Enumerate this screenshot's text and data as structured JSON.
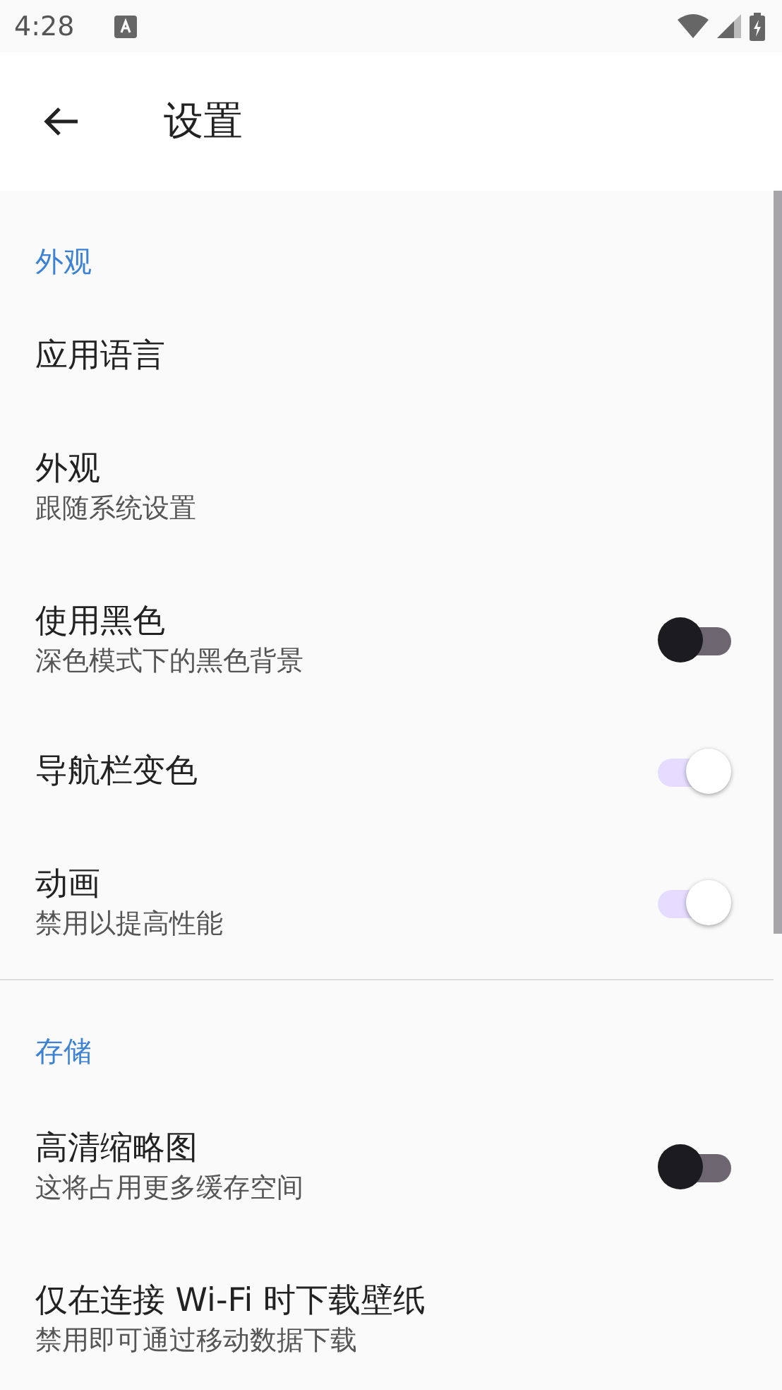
{
  "status_bar": {
    "time": "4:28"
  },
  "app_bar": {
    "title": "设置"
  },
  "sections": [
    {
      "title": "外观",
      "items": [
        {
          "kind": "plain",
          "title": "应用语言"
        },
        {
          "kind": "plain",
          "title": "外观",
          "subtitle": "跟随系统设置"
        },
        {
          "kind": "switch",
          "title": "使用黑色",
          "subtitle": "深色模式下的黑色背景",
          "on": false
        },
        {
          "kind": "switch",
          "title": "导航栏变色",
          "on": true
        },
        {
          "kind": "switch",
          "title": "动画",
          "subtitle": "禁用以提高性能",
          "on": true
        }
      ]
    },
    {
      "title": "存储",
      "items": [
        {
          "kind": "switch",
          "title": "高清缩略图",
          "subtitle": "这将占用更多缓存空间",
          "on": false
        },
        {
          "kind": "plain",
          "title": "仅在连接 Wi-Fi 时下载壁纸",
          "subtitle": "禁用即可通过移动数据下载"
        }
      ]
    }
  ]
}
